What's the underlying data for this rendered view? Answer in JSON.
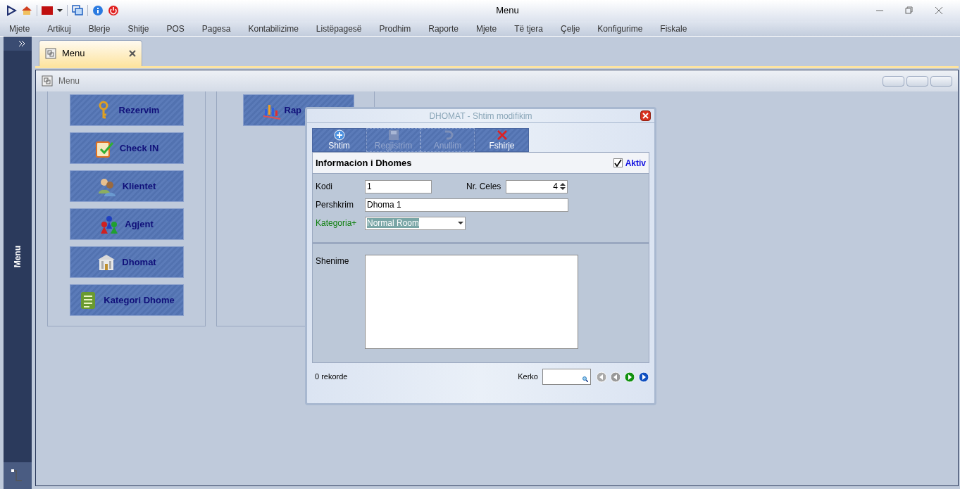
{
  "app_title": "Menu",
  "menu_bar": [
    "Mjete",
    "Artikuj",
    "Blerje",
    "Shitje",
    "POS",
    "Pagesa",
    "Kontabilizime",
    "Listëpagesë",
    "Prodhim",
    "Raporte",
    "Mjete",
    "Të tjera",
    "Çelje",
    "Konfigurime",
    "Fiskale"
  ],
  "sidebar": {
    "label": "Menu"
  },
  "tabs": [
    {
      "label": "Menu",
      "selected": true
    }
  ],
  "inner_window": {
    "title": "Menu"
  },
  "module_buttons": [
    {
      "label": "Rezervim"
    },
    {
      "label": "Check IN"
    },
    {
      "label": "Klientet"
    },
    {
      "label": "Agjent"
    },
    {
      "label": "Dhomat"
    },
    {
      "label": "Kategori Dhome"
    }
  ],
  "report_buttons": [
    {
      "label": "Rap"
    }
  ],
  "dialog": {
    "title": "DHOMAT - Shtim modifikim",
    "toolbar": [
      {
        "label": "Shtim",
        "disabled": false
      },
      {
        "label": "Regjistrim",
        "disabled": true
      },
      {
        "label": "Anullim",
        "disabled": true
      },
      {
        "label": "Fshirje",
        "disabled": false
      }
    ],
    "section_title": "Informacion i Dhomes",
    "aktiv": {
      "label": "Aktiv",
      "checked": true
    },
    "kodi": {
      "label": "Kodi",
      "value": "1"
    },
    "nr_celes": {
      "label": "Nr. Celes",
      "value": "4"
    },
    "pershkrim": {
      "label": "Pershkrim",
      "value": "Dhoma 1"
    },
    "kategoria": {
      "label": "Kategoria+",
      "value": "Normal Room"
    },
    "shenime": {
      "label": "Shenime"
    },
    "record_count": "0 rekorde",
    "search": {
      "label": "Kerko"
    }
  }
}
